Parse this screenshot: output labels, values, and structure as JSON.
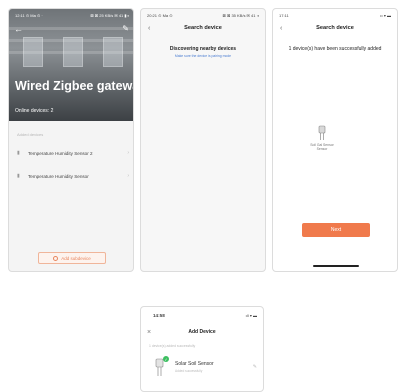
{
  "phone1": {
    "status_time": "12:11 ⊙ Ma ⊙ ·",
    "status_right": "⊠ ⊠ 25 KB/s ✉ 41 ▮◑",
    "title": "Wired Zigbee gateway",
    "online": "Online devices: 2",
    "section_label": "Added devices",
    "devices": [
      {
        "label": "Temperature Humidity Sensor 2"
      },
      {
        "label": "Temperature Humidity Sensor"
      }
    ],
    "add_button": "Add subdevice"
  },
  "phone2": {
    "status_time": "20:21 ⊙ Ma ⊙",
    "status_right": "⊠ ⊠ 35 KB/s ✉ 41 ◑",
    "nav_title": "Search device",
    "discovering": "Discovering nearby devices",
    "hint": "Make sure the device is pairing mode"
  },
  "phone3": {
    "status_time": "17:11",
    "status_right": "•• ▾ ▬",
    "nav_title": "Search device",
    "added_message": "1 device(s) have been successfully added",
    "sensor_label": "Soil Gal Sensor",
    "sensor_sublabel": "Sensor",
    "next_button": "Next"
  },
  "phone4": {
    "status_time": "14:58",
    "status_right": "•ll ▾ ▬",
    "nav_title": "Add Device",
    "section_label": "1 device(s) added successfully",
    "device_name": "Solar Soil Sensor",
    "device_sub": "Added successfully"
  },
  "icons": {
    "back": "back-arrow-icon",
    "edit": "edit-pencil-icon",
    "close": "close-icon",
    "check": "check-icon"
  },
  "colors": {
    "accent": "#f07a4c",
    "link": "#4a7cd1",
    "success": "#3cbf60"
  }
}
